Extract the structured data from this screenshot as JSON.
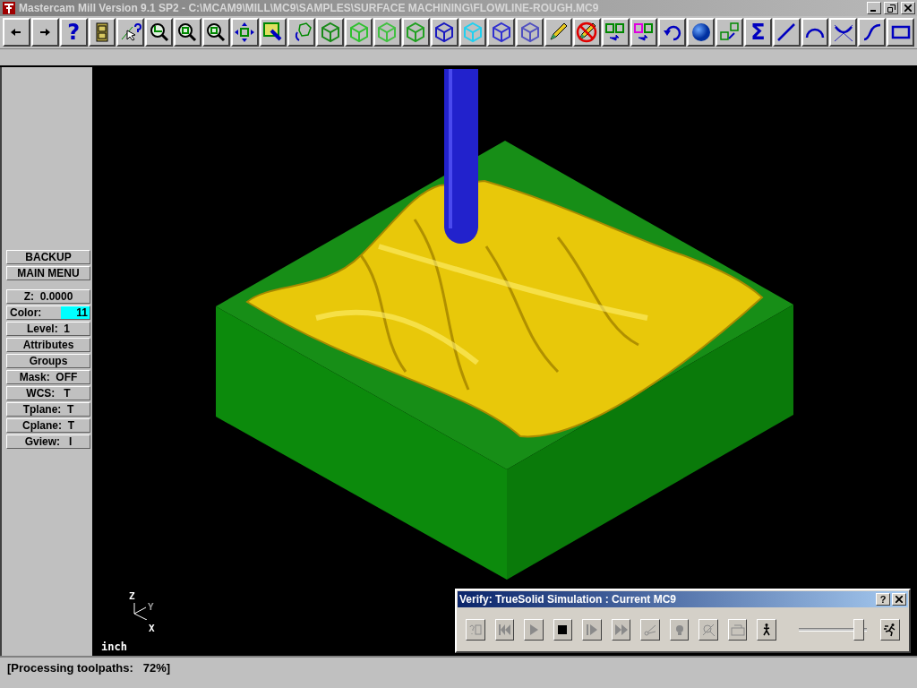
{
  "window": {
    "title": "Mastercam Mill Version 9.1 SP2 - C:\\MCAM9\\MILL\\MC9\\SAMPLES\\SURFACE MACHINING\\FLOWLINE-ROUGH.MC9"
  },
  "toolbar": [
    {
      "kind": "back"
    },
    {
      "kind": "forward"
    },
    {
      "kind": "text",
      "label": "?"
    },
    {
      "kind": "cabinet"
    },
    {
      "kind": "pointer-help"
    },
    {
      "kind": "zoom-window"
    },
    {
      "kind": "zoom"
    },
    {
      "kind": "zoom-8"
    },
    {
      "kind": "pan"
    },
    {
      "kind": "paint"
    },
    {
      "kind": "rotate"
    },
    {
      "kind": "cube",
      "color": "#188a18"
    },
    {
      "kind": "cube",
      "color": "#30c030"
    },
    {
      "kind": "cube",
      "color": "#40c040"
    },
    {
      "kind": "cube",
      "color": "#20a020"
    },
    {
      "kind": "cube",
      "color": "#1818c0"
    },
    {
      "kind": "cube",
      "color": "#20d0f0"
    },
    {
      "kind": "cube",
      "color": "#3030d0"
    },
    {
      "kind": "cube",
      "color": "#5050c0"
    },
    {
      "kind": "pencil"
    },
    {
      "kind": "no-pencil"
    },
    {
      "kind": "translate"
    },
    {
      "kind": "translate-color"
    },
    {
      "kind": "undo"
    },
    {
      "kind": "sphere"
    },
    {
      "kind": "cubes"
    },
    {
      "kind": "text",
      "label": "Σ"
    },
    {
      "kind": "line"
    },
    {
      "kind": "arc"
    },
    {
      "kind": "fillet"
    },
    {
      "kind": "spline"
    },
    {
      "kind": "rectangle"
    }
  ],
  "menu": {
    "top": [
      {
        "label": "BACKUP"
      },
      {
        "label": "MAIN MENU"
      }
    ],
    "settings": [
      {
        "label": "Z:  0.0000"
      },
      {
        "label": "Color:",
        "value": "11",
        "color": "#00ffff"
      },
      {
        "label": "Level:  1"
      },
      {
        "label": "Attributes"
      },
      {
        "label": "Groups"
      },
      {
        "label": "Mask:  OFF"
      },
      {
        "label": "WCS:   T"
      },
      {
        "label": "Tplane:  T"
      },
      {
        "label": "Cplane:  T"
      },
      {
        "label": "Gview:   I"
      }
    ]
  },
  "viewport": {
    "axes": {
      "z": "Z",
      "y": "Y",
      "x": "X"
    },
    "units": "inch"
  },
  "verify": {
    "title": "Verify: TrueSolid Simulation : Current MC9",
    "help": "?",
    "buttons": [
      {
        "kind": "options",
        "disabled": true
      },
      {
        "kind": "rewind",
        "disabled": true
      },
      {
        "kind": "play",
        "disabled": true
      },
      {
        "kind": "stop",
        "disabled": false
      },
      {
        "kind": "step",
        "disabled": true
      },
      {
        "kind": "fast",
        "disabled": true
      },
      {
        "kind": "cut",
        "disabled": true
      },
      {
        "kind": "light",
        "disabled": true
      },
      {
        "kind": "zoom",
        "disabled": true
      },
      {
        "kind": "save",
        "disabled": true
      },
      {
        "kind": "walk",
        "disabled": false
      }
    ],
    "speed": {
      "level": 0.93
    },
    "run": {
      "disabled": false
    }
  },
  "status_bar": {
    "text": "[Processing toolpaths:   72%]"
  }
}
